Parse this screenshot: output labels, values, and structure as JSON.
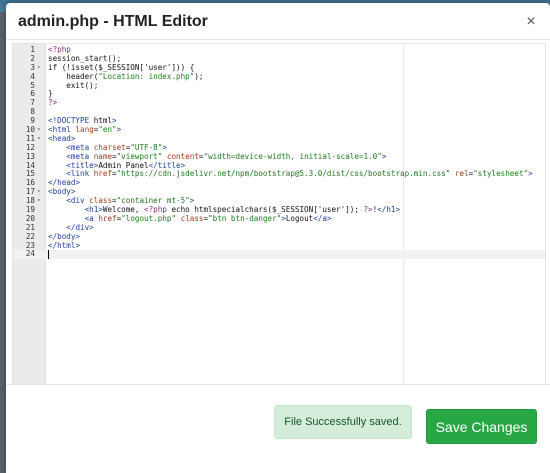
{
  "modal": {
    "title": "admin.php - HTML Editor",
    "close_label": "×"
  },
  "editor": {
    "lines": [
      {
        "n": "1",
        "fold": "",
        "code": "<?php"
      },
      {
        "n": "2",
        "fold": "",
        "code": "session_start();"
      },
      {
        "n": "3",
        "fold": "▾",
        "code": "if (!isset($_SESSION['user'])) {"
      },
      {
        "n": "4",
        "fold": "",
        "code": "    header(\"Location: index.php\");"
      },
      {
        "n": "5",
        "fold": "",
        "code": "    exit();"
      },
      {
        "n": "6",
        "fold": "",
        "code": "}"
      },
      {
        "n": "7",
        "fold": "",
        "code": "?>"
      },
      {
        "n": "8",
        "fold": "",
        "code": ""
      },
      {
        "n": "9",
        "fold": "",
        "code": "<!DOCTYPE html>"
      },
      {
        "n": "10",
        "fold": "▾",
        "code": "<html lang=\"en\">"
      },
      {
        "n": "11",
        "fold": "▾",
        "code": "<head>"
      },
      {
        "n": "12",
        "fold": "",
        "code": "    <meta charset=\"UTF-8\">"
      },
      {
        "n": "13",
        "fold": "",
        "code": "    <meta name=\"viewport\" content=\"width=device-width, initial-scale=1.0\">"
      },
      {
        "n": "14",
        "fold": "",
        "code": "    <title>Admin Panel</title>"
      },
      {
        "n": "15",
        "fold": "",
        "code": "    <link href=\"https://cdn.jsdelivr.net/npm/bootstrap@5.3.0/dist/css/bootstrap.min.css\" rel=\"stylesheet\">"
      },
      {
        "n": "16",
        "fold": "",
        "code": "</head>"
      },
      {
        "n": "17",
        "fold": "▾",
        "code": "<body>"
      },
      {
        "n": "18",
        "fold": "▾",
        "code": "    <div class=\"container mt-5\">"
      },
      {
        "n": "19",
        "fold": "",
        "code": "        <h1>Welcome, <?php echo htmlspecialchars($_SESSION['user']); ?>!</h1>"
      },
      {
        "n": "20",
        "fold": "",
        "code": "        <a href=\"logout.php\" class=\"btn btn-danger\">Logout</a>"
      },
      {
        "n": "21",
        "fold": "",
        "code": "    </div>"
      },
      {
        "n": "22",
        "fold": "",
        "code": "</body>"
      },
      {
        "n": "23",
        "fold": "",
        "code": "</html>"
      },
      {
        "n": "24",
        "fold": "",
        "code": ""
      }
    ],
    "active_line": 24
  },
  "footer": {
    "alert_text": "File Successfully saved.",
    "save_label": "Save Changes"
  },
  "colors": {
    "save_button": "#28a745",
    "alert_background": "#d4edda",
    "alert_text": "#155724"
  }
}
